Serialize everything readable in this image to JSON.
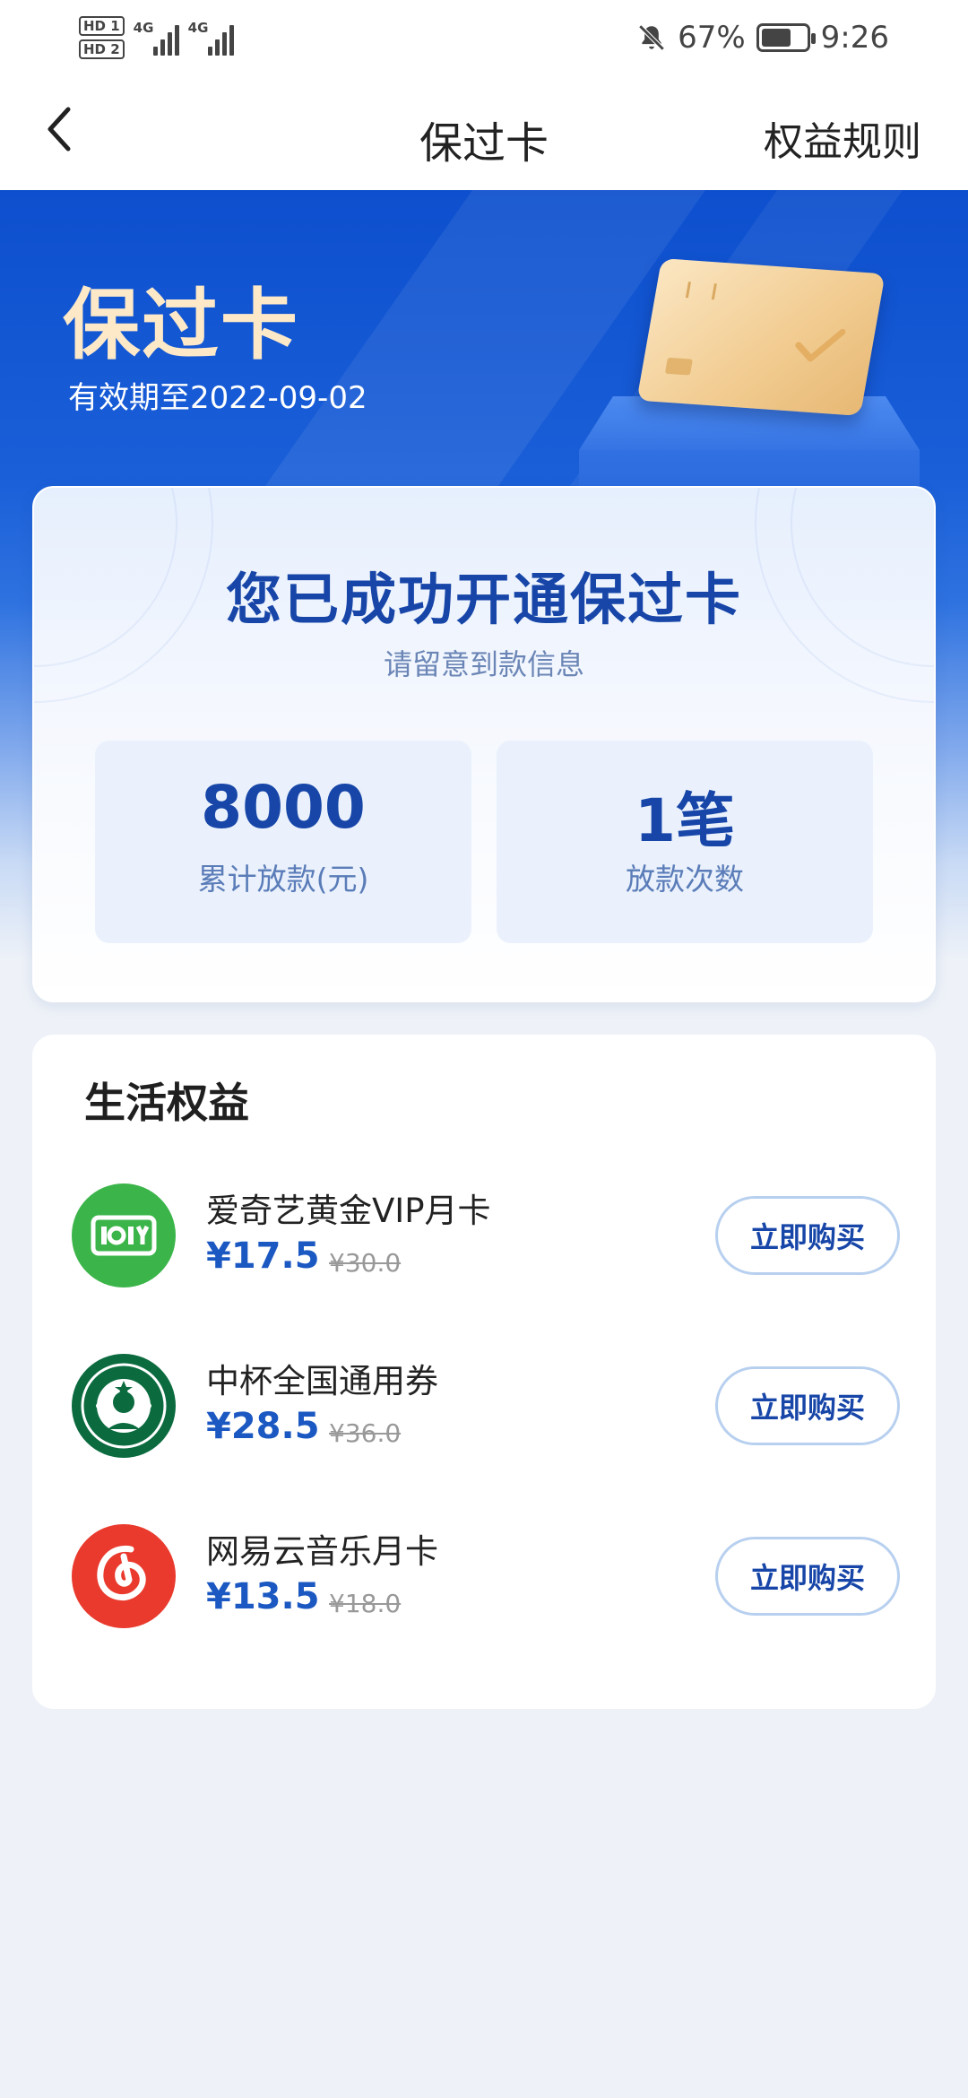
{
  "status_bar": {
    "sim1_label": "HD 1",
    "sim2_label": "HD 2",
    "network1": "4G",
    "network2": "4G",
    "battery_percent": "67%",
    "battery_level": 0.67,
    "time": "9:26"
  },
  "nav": {
    "title": "保过卡",
    "right_link": "权益规则"
  },
  "banner": {
    "title": "保过卡",
    "validity": "有效期至2022-09-02"
  },
  "success": {
    "title": "您已成功开通保过卡",
    "subtitle": "请留意到款信息",
    "stats": [
      {
        "value": "8000",
        "label": "累计放款(元)"
      },
      {
        "value": "1笔",
        "label": "放款次数"
      }
    ]
  },
  "benefits": {
    "title": "生活权益",
    "items": [
      {
        "name": "爱奇艺黄金VIP月卡",
        "price": "¥17.5",
        "original": "¥30.0",
        "button": "立即购买",
        "logo": "iqiyi-logo",
        "logo_color": "#3bb54a"
      },
      {
        "name": "中杯全国通用券",
        "price": "¥28.5",
        "original": "¥36.0",
        "button": "立即购买",
        "logo": "starbucks-logo",
        "logo_color": "#0b6b3f"
      },
      {
        "name": "网易云音乐月卡",
        "price": "¥13.5",
        "original": "¥18.0",
        "button": "立即购买",
        "logo": "netease-music-logo",
        "logo_color": "#e93a2d"
      }
    ]
  },
  "colors": {
    "brand_blue": "#1746a8",
    "banner_blue": "#0d4fce",
    "gold_text": "#fde9c8",
    "page_bg": "#eef2f8"
  }
}
